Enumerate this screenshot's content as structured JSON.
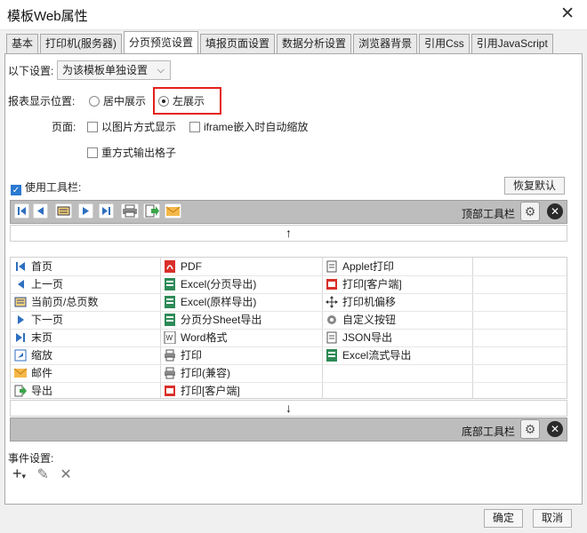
{
  "window": {
    "title": "模板Web属性",
    "close_glyph": "✕"
  },
  "tabs": [
    {
      "label": "基本"
    },
    {
      "label": "打印机(服务器)"
    },
    {
      "label": "分页预览设置",
      "active": true
    },
    {
      "label": "填报页面设置"
    },
    {
      "label": "数据分析设置"
    },
    {
      "label": "浏览器背景"
    },
    {
      "label": "引用Css"
    },
    {
      "label": "引用JavaScript"
    }
  ],
  "settings": {
    "scope_label": "以下设置:",
    "scope_value": "为该模板单独设置",
    "position_label": "报表显示位置:",
    "position_center": "居中展示",
    "position_left": "左展示",
    "position_selected": "left",
    "page_label": "页面:",
    "as_image": "以图片方式显示",
    "iframe_zoom": "iframe嵌入时自动缩放",
    "repeat_cells": "重方式输出格子"
  },
  "toolbar": {
    "use_label": "使用工具栏:",
    "use_checked": true,
    "restore_label": "恢复默认",
    "top_label": "顶部工具栏",
    "bottom_label": "底部工具栏",
    "up_arrow": "↑",
    "down_arrow": "↓",
    "items": [
      [
        "首页",
        "PDF",
        "Applet打印"
      ],
      [
        "上一页",
        "Excel(分页导出)",
        "打印[客户端]"
      ],
      [
        "当前页/总页数",
        "Excel(原样导出)",
        "打印机偏移"
      ],
      [
        "下一页",
        "分页分Sheet导出",
        "自定义按钮"
      ],
      [
        "末页",
        "Word格式",
        "JSON导出"
      ],
      [
        "缩放",
        "打印",
        "Excel流式导出"
      ],
      [
        "邮件",
        "打印(兼容)",
        ""
      ],
      [
        "导出",
        "打印[客户端]",
        ""
      ]
    ]
  },
  "events": {
    "label": "事件设置:"
  },
  "footer": {
    "ok": "确定",
    "cancel": "取消"
  },
  "colors": {
    "accent": "#2b79d0",
    "highlight": "#e3201b",
    "strip": "#bdbdbd"
  }
}
